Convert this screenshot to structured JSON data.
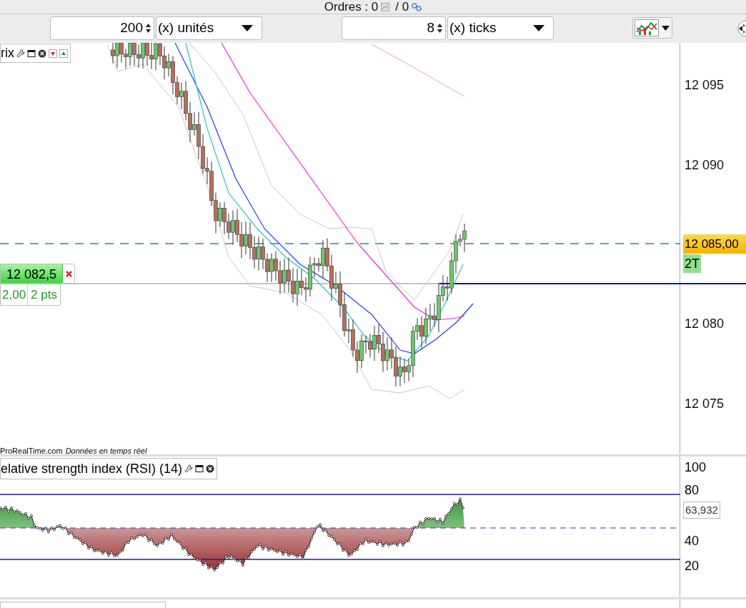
{
  "orders_bar": {
    "label": "Ordres : 0",
    "separator": "/ 0"
  },
  "toolbar": [
    {
      "kind": "spin",
      "value": "200"
    },
    {
      "kind": "dropdown",
      "value": "(x) unités"
    },
    {
      "kind": "spin",
      "value": "8"
    },
    {
      "kind": "dropdown",
      "value": "(x) ticks"
    }
  ],
  "price_panel": {
    "title": "rix",
    "axis_labels": [
      "12 095",
      "12 090",
      "12 080",
      "12 075"
    ],
    "current_price": "12 085,00",
    "position_tag": "2T",
    "order": {
      "price": "12 082,5",
      "quantity": "2,00",
      "distance": "2 pts"
    },
    "footer": {
      "source": "ProRealTime.com",
      "note": "Données en temps réel"
    }
  },
  "rsi_panel": {
    "title": "elative strength index (RSI) (14)",
    "axis_labels": [
      "100",
      "80",
      "40",
      "20"
    ],
    "value": "63,932"
  }
}
